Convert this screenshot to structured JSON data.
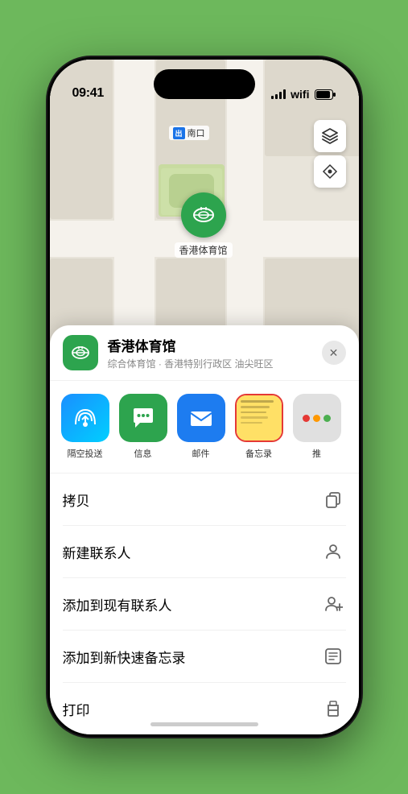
{
  "statusBar": {
    "time": "09:41",
    "locationArrow": "▲"
  },
  "map": {
    "label": "南口",
    "exitBadge": "出",
    "pinLabel": "香港体育馆"
  },
  "venueCard": {
    "name": "香港体育馆",
    "subtitle": "综合体育馆 · 香港特别行政区 油尖旺区",
    "closeLabel": "✕"
  },
  "shareRow": [
    {
      "id": "airdrop",
      "label": "隔空投送",
      "type": "airdrop"
    },
    {
      "id": "messages",
      "label": "信息",
      "type": "messages"
    },
    {
      "id": "mail",
      "label": "邮件",
      "type": "mail"
    },
    {
      "id": "notes",
      "label": "备忘录",
      "type": "notes"
    },
    {
      "id": "more",
      "label": "推",
      "type": "more"
    }
  ],
  "actionItems": [
    {
      "id": "copy",
      "label": "拷贝",
      "icon": "copy"
    },
    {
      "id": "new-contact",
      "label": "新建联系人",
      "icon": "person"
    },
    {
      "id": "add-contact",
      "label": "添加到现有联系人",
      "icon": "person-add"
    },
    {
      "id": "quick-note",
      "label": "添加到新快速备忘录",
      "icon": "quick-note"
    },
    {
      "id": "print",
      "label": "打印",
      "icon": "print"
    }
  ]
}
